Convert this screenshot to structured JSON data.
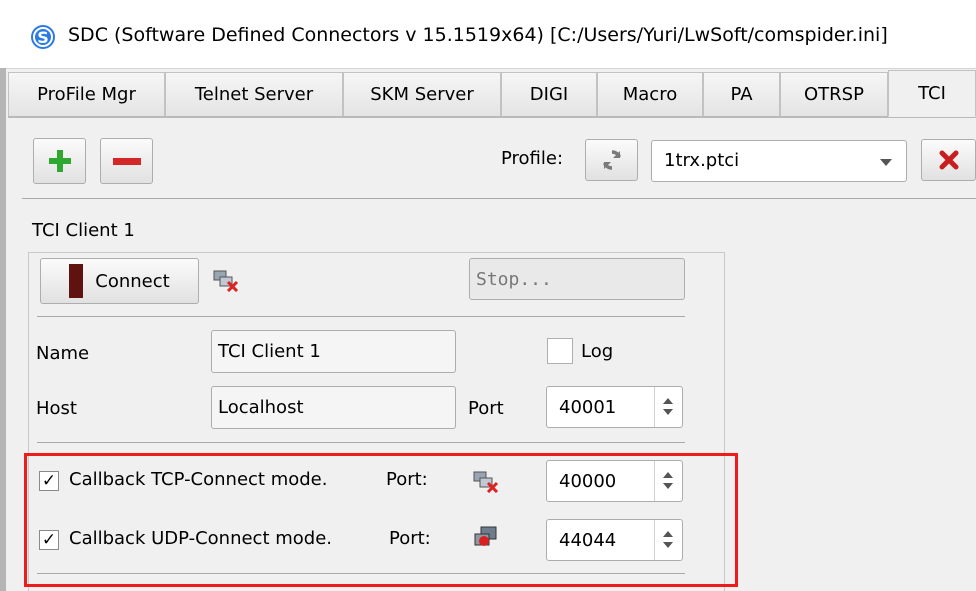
{
  "window": {
    "title": "SDC (Software Defined Connectors v 15.1519x64) [C:/Users/Yuri/LwSoft/comspider.ini]"
  },
  "tabs": [
    {
      "label": "ProFile Mgr"
    },
    {
      "label": "Telnet Server"
    },
    {
      "label": "SKM Server"
    },
    {
      "label": "DIGI"
    },
    {
      "label": "Macro"
    },
    {
      "label": "PA"
    },
    {
      "label": "OTRSP"
    },
    {
      "label": "TCI"
    }
  ],
  "active_tab": "TCI",
  "toolbar": {
    "profile_label": "Profile:",
    "profile_value": "1trx.ptci"
  },
  "client": {
    "title": "TCI Client 1",
    "connect_label": "Connect",
    "status_text": "Stop...",
    "name_label": "Name",
    "name_value": "TCI Client 1",
    "log_label": "Log",
    "log_checked": false,
    "host_label": "Host",
    "host_value": "Localhost",
    "port_label": "Port",
    "port_value": "40001"
  },
  "callbacks": {
    "tcp_label": "Callback TCP-Connect mode.",
    "tcp_checked": true,
    "tcp_port_label": "Port:",
    "tcp_port_value": "40000",
    "udp_label": "Callback UDP-Connect mode.",
    "udp_checked": true,
    "udp_port_label": "Port:",
    "udp_port_value": "44044",
    "check_mark": "✓"
  },
  "colors": {
    "highlight_box": "#ee1c1c",
    "add_icon": "#2fa82f",
    "remove_icon": "#d42727",
    "connect_indicator": "#5e1310"
  }
}
